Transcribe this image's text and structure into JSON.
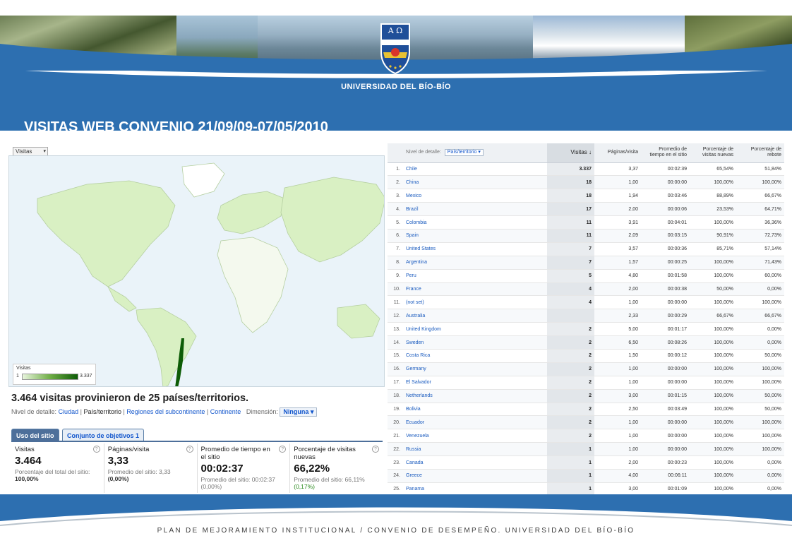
{
  "header": {
    "university": "UNIVERSIDAD DEL BÍO-BÍO",
    "title": "VISITAS WEB CONVENIO 21/09/09-07/05/2010",
    "crest_letters": "A Ω"
  },
  "map": {
    "metric_selector": "Visitas",
    "legend_title": "Visitas",
    "legend_min": "1",
    "legend_max": "3.337"
  },
  "summary": {
    "headline": "3.464 visitas provinieron de 25 países/territorios.",
    "detail_label": "Nivel de detalle:",
    "detail_city": "Ciudad",
    "detail_country": "País/territorio",
    "detail_subcontinent": "Regiones del subcontinente",
    "detail_continent": "Continente",
    "dimension_label": "Dimensión:",
    "dimension_value": "Ninguna"
  },
  "tabs": [
    "Uso del sitio",
    "Conjunto de objetivos 1"
  ],
  "metrics": [
    {
      "name": "Visitas",
      "value": "3.464",
      "sub1": "Porcentaje del total del sitio:",
      "sub2": "100,00%"
    },
    {
      "name": "Páginas/visita",
      "value": "3,33",
      "sub1": "Promedio del sitio: 3,33",
      "sub2": "(0,00%)"
    },
    {
      "name": "Promedio de tiempo en el sitio",
      "value": "00:02:37",
      "sub1": "Promedio del sitio: 00:02:37",
      "sub2": "(0,00%)"
    },
    {
      "name": "Porcentaje de visitas nuevas",
      "value": "66,22%",
      "sub1": "Promedio del sitio: 66,11%",
      "sub2": "(0,17%)"
    }
  ],
  "table": {
    "detail_label": "Nivel de detalle:",
    "detail_value": "País/territorio",
    "columns": [
      "Visitas ↓",
      "Páginas/visita",
      "Promedio de tiempo en el sitio",
      "Porcentaje de visitas nuevas",
      "Porcentaje de rebote"
    ],
    "rows": [
      [
        "1.",
        "Chile",
        "3.337",
        "3,37",
        "00:02:39",
        "65,54%",
        "51,84%"
      ],
      [
        "2.",
        "China",
        "18",
        "1,00",
        "00:00:00",
        "100,00%",
        "100,00%"
      ],
      [
        "3.",
        "Mexico",
        "18",
        "1,94",
        "00:03:46",
        "88,89%",
        "66,67%"
      ],
      [
        "4.",
        "Brazil",
        "17",
        "2,00",
        "00:00:06",
        "23,53%",
        "64,71%"
      ],
      [
        "5.",
        "Colombia",
        "11",
        "3,91",
        "00:04:01",
        "100,00%",
        "36,36%"
      ],
      [
        "6.",
        "Spain",
        "11",
        "2,09",
        "00:03:15",
        "90,91%",
        "72,73%"
      ],
      [
        "7.",
        "United States",
        "7",
        "3,57",
        "00:00:36",
        "85,71%",
        "57,14%"
      ],
      [
        "8.",
        "Argentina",
        "7",
        "1,57",
        "00:00:25",
        "100,00%",
        "71,43%"
      ],
      [
        "9.",
        "Peru",
        "5",
        "4,80",
        "00:01:58",
        "100,00%",
        "60,00%"
      ],
      [
        "10.",
        "France",
        "4",
        "2,00",
        "00:00:38",
        "50,00%",
        "0,00%"
      ],
      [
        "11.",
        "(not set)",
        "4",
        "1,00",
        "00:00:00",
        "100,00%",
        "100,00%"
      ],
      [
        "12.",
        "Australia",
        "",
        "2,33",
        "00:00:29",
        "66,67%",
        "66,67%"
      ],
      [
        "13.",
        "United Kingdom",
        "2",
        "5,00",
        "00:01:17",
        "100,00%",
        "0,00%"
      ],
      [
        "14.",
        "Sweden",
        "2",
        "6,50",
        "00:08:26",
        "100,00%",
        "0,00%"
      ],
      [
        "15.",
        "Costa Rica",
        "2",
        "1,50",
        "00:00:12",
        "100,00%",
        "50,00%"
      ],
      [
        "16.",
        "Germany",
        "2",
        "1,00",
        "00:00:00",
        "100,00%",
        "100,00%"
      ],
      [
        "17.",
        "El Salvador",
        "2",
        "1,00",
        "00:00:00",
        "100,00%",
        "100,00%"
      ],
      [
        "18.",
        "Netherlands",
        "2",
        "3,00",
        "00:01:15",
        "100,00%",
        "50,00%"
      ],
      [
        "19.",
        "Bolivia",
        "2",
        "2,50",
        "00:03:49",
        "100,00%",
        "50,00%"
      ],
      [
        "20.",
        "Ecuador",
        "2",
        "1,00",
        "00:00:00",
        "100,00%",
        "100,00%"
      ],
      [
        "21.",
        "Venezuela",
        "2",
        "1,00",
        "00:00:00",
        "100,00%",
        "100,00%"
      ],
      [
        "22.",
        "Russia",
        "1",
        "1,00",
        "00:00:00",
        "100,00%",
        "100,00%"
      ],
      [
        "23.",
        "Canada",
        "1",
        "2,00",
        "00:00:23",
        "100,00%",
        "0,00%"
      ],
      [
        "24.",
        "Greece",
        "1",
        "4,00",
        "00:06:11",
        "100,00%",
        "0,00%"
      ],
      [
        "25.",
        "Panama",
        "1",
        "3,00",
        "00:01:09",
        "100,00%",
        "0,00%"
      ]
    ]
  },
  "footer": {
    "text": "PLAN DE MEJORAMIENTO INSTITUCIONAL / CONVENIO DE DESEMPEÑO. UNIVERSIDAD DEL BÍO-BÍO"
  },
  "colors": {
    "brand_blue": "#2d6fb0",
    "map_land": "#d9f0c3",
    "map_chile": "#0d5c06",
    "link": "#1a5bbf"
  }
}
